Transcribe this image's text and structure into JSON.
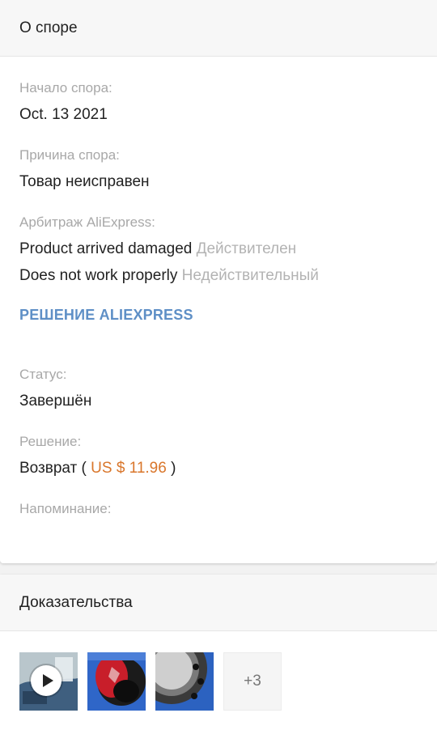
{
  "dispute": {
    "header": "О споре",
    "start_label": "Начало спора:",
    "start_value": "Oct. 13 2021",
    "reason_label": "Причина спора:",
    "reason_value": "Товар неисправен",
    "arbitration_label": "Арбитраж AliExpress:",
    "arbitration_items": [
      {
        "reason": "Product arrived damaged",
        "verdict": "Действителен"
      },
      {
        "reason": "Does not work properly",
        "verdict": "Недействительный"
      }
    ],
    "decision_link": "РЕШЕНИЕ ALIEXPRESS",
    "status_label": "Статус:",
    "status_value": "Завершён",
    "resolution_label": "Решение:",
    "resolution_prefix": "Возврат (",
    "resolution_amount": "US $ 11.96",
    "resolution_suffix": ")",
    "reminder_label": "Напоминание:"
  },
  "evidence": {
    "header": "Доказательства",
    "more_count": "+3",
    "thumbnails": [
      {
        "type": "video",
        "icon": "play-icon"
      },
      {
        "type": "photo"
      },
      {
        "type": "photo"
      }
    ]
  },
  "colors": {
    "link": "#5e8fc6",
    "price": "#d9762b",
    "label": "#a8a8a8"
  }
}
